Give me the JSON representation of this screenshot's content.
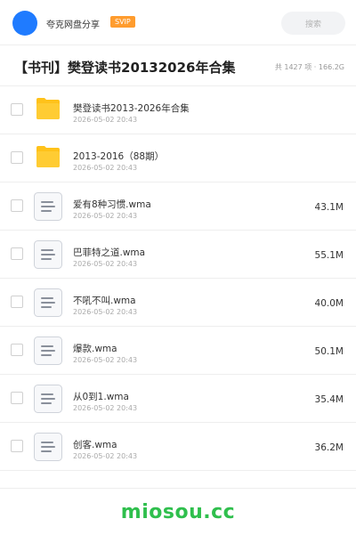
{
  "header": {
    "brand": "夸克网盘分享",
    "badge": "SVIP",
    "search_placeholder": "搜索"
  },
  "folder": {
    "title": "【书刊】樊登读书20132026年合集",
    "meta": "共 1427 项 · 166.2G"
  },
  "items": [
    {
      "type": "folder",
      "name": "樊登读书2013-2026年合集",
      "date": "2026-05-02 20:43",
      "size": ""
    },
    {
      "type": "folder",
      "name": "2013-2016（88期）",
      "date": "2026-05-02 20:43",
      "size": ""
    },
    {
      "type": "file",
      "name": "爱有8种习惯.wma",
      "date": "2026-05-02 20:43",
      "size": "43.1M"
    },
    {
      "type": "file",
      "name": "巴菲特之道.wma",
      "date": "2026-05-02 20:43",
      "size": "55.1M"
    },
    {
      "type": "file",
      "name": "不吼不叫.wma",
      "date": "2026-05-02 20:43",
      "size": "40.0M"
    },
    {
      "type": "file",
      "name": "爆款.wma",
      "date": "2026-05-02 20:43",
      "size": "50.1M"
    },
    {
      "type": "file",
      "name": "从0到1.wma",
      "date": "2026-05-02 20:43",
      "size": "35.4M"
    },
    {
      "type": "file",
      "name": "创客.wma",
      "date": "2026-05-02 20:43",
      "size": "36.2M"
    }
  ],
  "footer": {
    "watermark": "miosou.cc"
  },
  "colors": {
    "avatar": "#1f7bff",
    "svip": "#ff9c2e",
    "folder": "#ffc21a",
    "watermark": "#2fbf4d"
  }
}
